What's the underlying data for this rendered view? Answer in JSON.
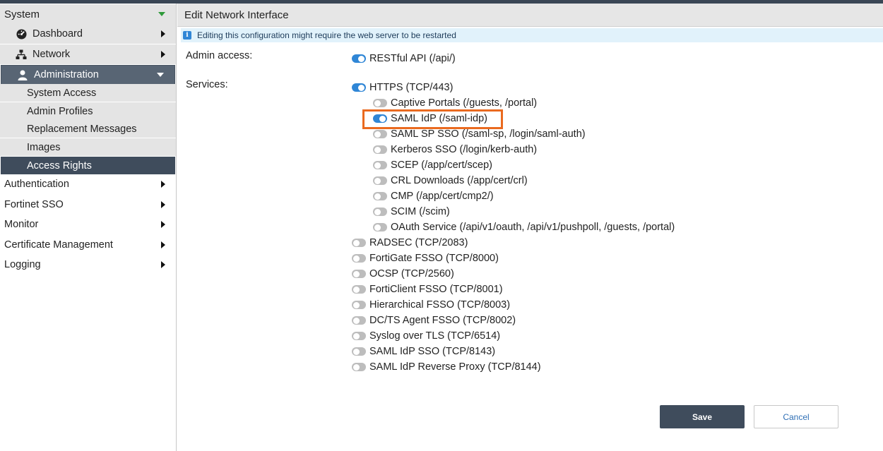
{
  "sidebar": {
    "system": "System",
    "dashboard": "Dashboard",
    "network": "Network",
    "administration": "Administration",
    "admin_items": [
      "System Access",
      "Admin Profiles",
      "Replacement Messages",
      "Images",
      "Access Rights"
    ],
    "top_items": [
      "Authentication",
      "Fortinet SSO",
      "Monitor",
      "Certificate Management",
      "Logging"
    ]
  },
  "header": {
    "title": "Edit Network Interface"
  },
  "notice": {
    "icon": "info-icon",
    "text": "Editing this configuration might require the web server to be restarted"
  },
  "form": {
    "admin_access_label": "Admin access:",
    "services_label": "Services:",
    "restful_api": {
      "label": "RESTful API (/api/)",
      "enabled": true
    },
    "https": {
      "label": "HTTPS (TCP/443)",
      "enabled": true
    },
    "https_sub": [
      {
        "label": "Captive Portals (/guests, /portal)",
        "enabled": false
      },
      {
        "label": "SAML IdP (/saml-idp)",
        "enabled": true
      },
      {
        "label": "SAML SP SSO (/saml-sp, /login/saml-auth)",
        "enabled": false
      },
      {
        "label": "Kerberos SSO (/login/kerb-auth)",
        "enabled": false
      },
      {
        "label": "SCEP (/app/cert/scep)",
        "enabled": false
      },
      {
        "label": "CRL Downloads (/app/cert/crl)",
        "enabled": false
      },
      {
        "label": "CMP (/app/cert/cmp2/)",
        "enabled": false
      },
      {
        "label": "SCIM (/scim)",
        "enabled": false
      },
      {
        "label": "OAuth Service (/api/v1/oauth, /api/v1/pushpoll, /guests, /portal)",
        "enabled": false
      }
    ],
    "other_services": [
      {
        "label": "RADSEC (TCP/2083)",
        "enabled": false
      },
      {
        "label": "FortiGate FSSO (TCP/8000)",
        "enabled": false
      },
      {
        "label": "OCSP (TCP/2560)",
        "enabled": false
      },
      {
        "label": "FortiClient FSSO (TCP/8001)",
        "enabled": false
      },
      {
        "label": "Hierarchical FSSO (TCP/8003)",
        "enabled": false
      },
      {
        "label": "DC/TS Agent FSSO (TCP/8002)",
        "enabled": false
      },
      {
        "label": "Syslog over TLS (TCP/6514)",
        "enabled": false
      },
      {
        "label": "SAML IdP SSO (TCP/8143)",
        "enabled": false
      },
      {
        "label": "SAML IdP Reverse Proxy (TCP/8144)",
        "enabled": false
      }
    ]
  },
  "buttons": {
    "save": "Save",
    "cancel": "Cancel"
  },
  "colors": {
    "accent": "#2f86d6",
    "highlight": "#ea6a1f",
    "nav_active": "#3f4c5c"
  }
}
